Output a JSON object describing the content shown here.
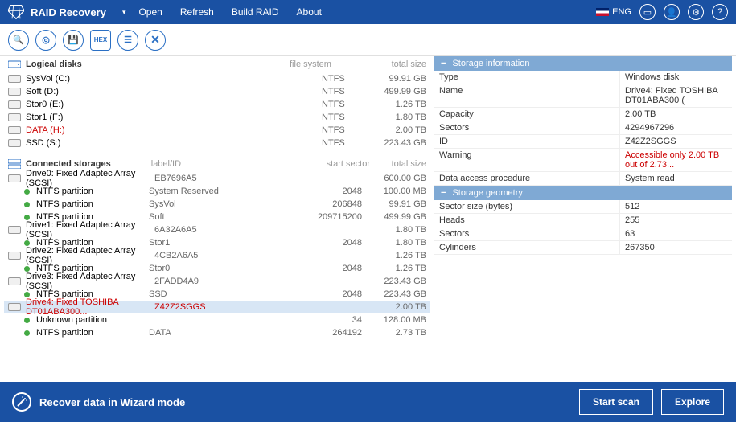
{
  "header": {
    "title": "RAID Recovery",
    "menu": [
      "Open",
      "Refresh",
      "Build RAID",
      "About"
    ],
    "lang": "ENG"
  },
  "sections": {
    "logical": {
      "title": "Logical disks",
      "col_fs": "file system",
      "col_ts": "total size"
    },
    "storages": {
      "title": "Connected storages",
      "col_lbl": "label/ID",
      "col_ss": "start sector",
      "col_ts": "total size"
    }
  },
  "logical": [
    {
      "name": "SysVol (C:)",
      "fs": "NTFS",
      "size": "99.91 GB"
    },
    {
      "name": "Soft (D:)",
      "fs": "NTFS",
      "size": "499.99 GB"
    },
    {
      "name": "Stor0 (E:)",
      "fs": "NTFS",
      "size": "1.26 TB"
    },
    {
      "name": "Stor1 (F:)",
      "fs": "NTFS",
      "size": "1.80 TB"
    },
    {
      "name": "DATA (H:)",
      "fs": "NTFS",
      "size": "2.00 TB",
      "red": true
    },
    {
      "name": "SSD (S:)",
      "fs": "NTFS",
      "size": "223.43 GB"
    }
  ],
  "storages": [
    {
      "type": "drive",
      "name": "Drive0: Fixed Adaptec Array (SCSI)",
      "label": "EB7696A5",
      "size": "600.00 GB"
    },
    {
      "type": "part",
      "name": "NTFS partition",
      "label": "System Reserved",
      "ss": "2048",
      "size": "100.00 MB"
    },
    {
      "type": "part",
      "name": "NTFS partition",
      "label": "SysVol",
      "ss": "206848",
      "size": "99.91 GB"
    },
    {
      "type": "part",
      "name": "NTFS partition",
      "label": "Soft",
      "ss": "209715200",
      "size": "499.99 GB"
    },
    {
      "type": "drive",
      "name": "Drive1: Fixed Adaptec Array (SCSI)",
      "label": "6A32A6A5",
      "size": "1.80 TB"
    },
    {
      "type": "part",
      "name": "NTFS partition",
      "label": "Stor1",
      "ss": "2048",
      "size": "1.80 TB"
    },
    {
      "type": "drive",
      "name": "Drive2: Fixed Adaptec Array (SCSI)",
      "label": "4CB2A6A5",
      "size": "1.26 TB"
    },
    {
      "type": "part",
      "name": "NTFS partition",
      "label": "Stor0",
      "ss": "2048",
      "size": "1.26 TB"
    },
    {
      "type": "drive",
      "name": "Drive3: Fixed Adaptec Array (SCSI)",
      "label": "2FADD4A9",
      "size": "223.43 GB"
    },
    {
      "type": "part",
      "name": "NTFS partition",
      "label": "SSD",
      "ss": "2048",
      "size": "223.43 GB"
    },
    {
      "type": "drive",
      "name": "Drive4: Fixed TOSHIBA DT01ABA300...",
      "label": "Z42Z2SGGS",
      "size": "2.00 TB",
      "red": true,
      "sel": true
    },
    {
      "type": "part",
      "name": "Unknown partition",
      "label": "",
      "ss": "34",
      "size": "128.00 MB"
    },
    {
      "type": "part",
      "name": "NTFS partition",
      "label": "DATA",
      "ss": "264192",
      "size": "2.73 TB"
    }
  ],
  "info": {
    "h1": "Storage information",
    "rows1": [
      {
        "k": "Type",
        "v": "Windows disk"
      },
      {
        "k": "Name",
        "v": "Drive4: Fixed TOSHIBA DT01ABA300 ("
      },
      {
        "k": "Capacity",
        "v": "2.00 TB"
      },
      {
        "k": "Sectors",
        "v": "4294967296"
      },
      {
        "k": "ID",
        "v": "Z42Z2SGGS"
      },
      {
        "k": "Warning",
        "v": "Accessible only 2.00 TB out of 2.73...",
        "red": true
      },
      {
        "k": "Data access procedure",
        "v": "System read"
      }
    ],
    "h2": "Storage geometry",
    "rows2": [
      {
        "k": "Sector size (bytes)",
        "v": "512"
      },
      {
        "k": "Heads",
        "v": "255"
      },
      {
        "k": "Sectors",
        "v": "63"
      },
      {
        "k": "Cylinders",
        "v": "267350"
      }
    ]
  },
  "footer": {
    "wizard": "Recover data in Wizard mode",
    "scan": "Start scan",
    "explore": "Explore"
  },
  "toolbar_hex": "HEX"
}
